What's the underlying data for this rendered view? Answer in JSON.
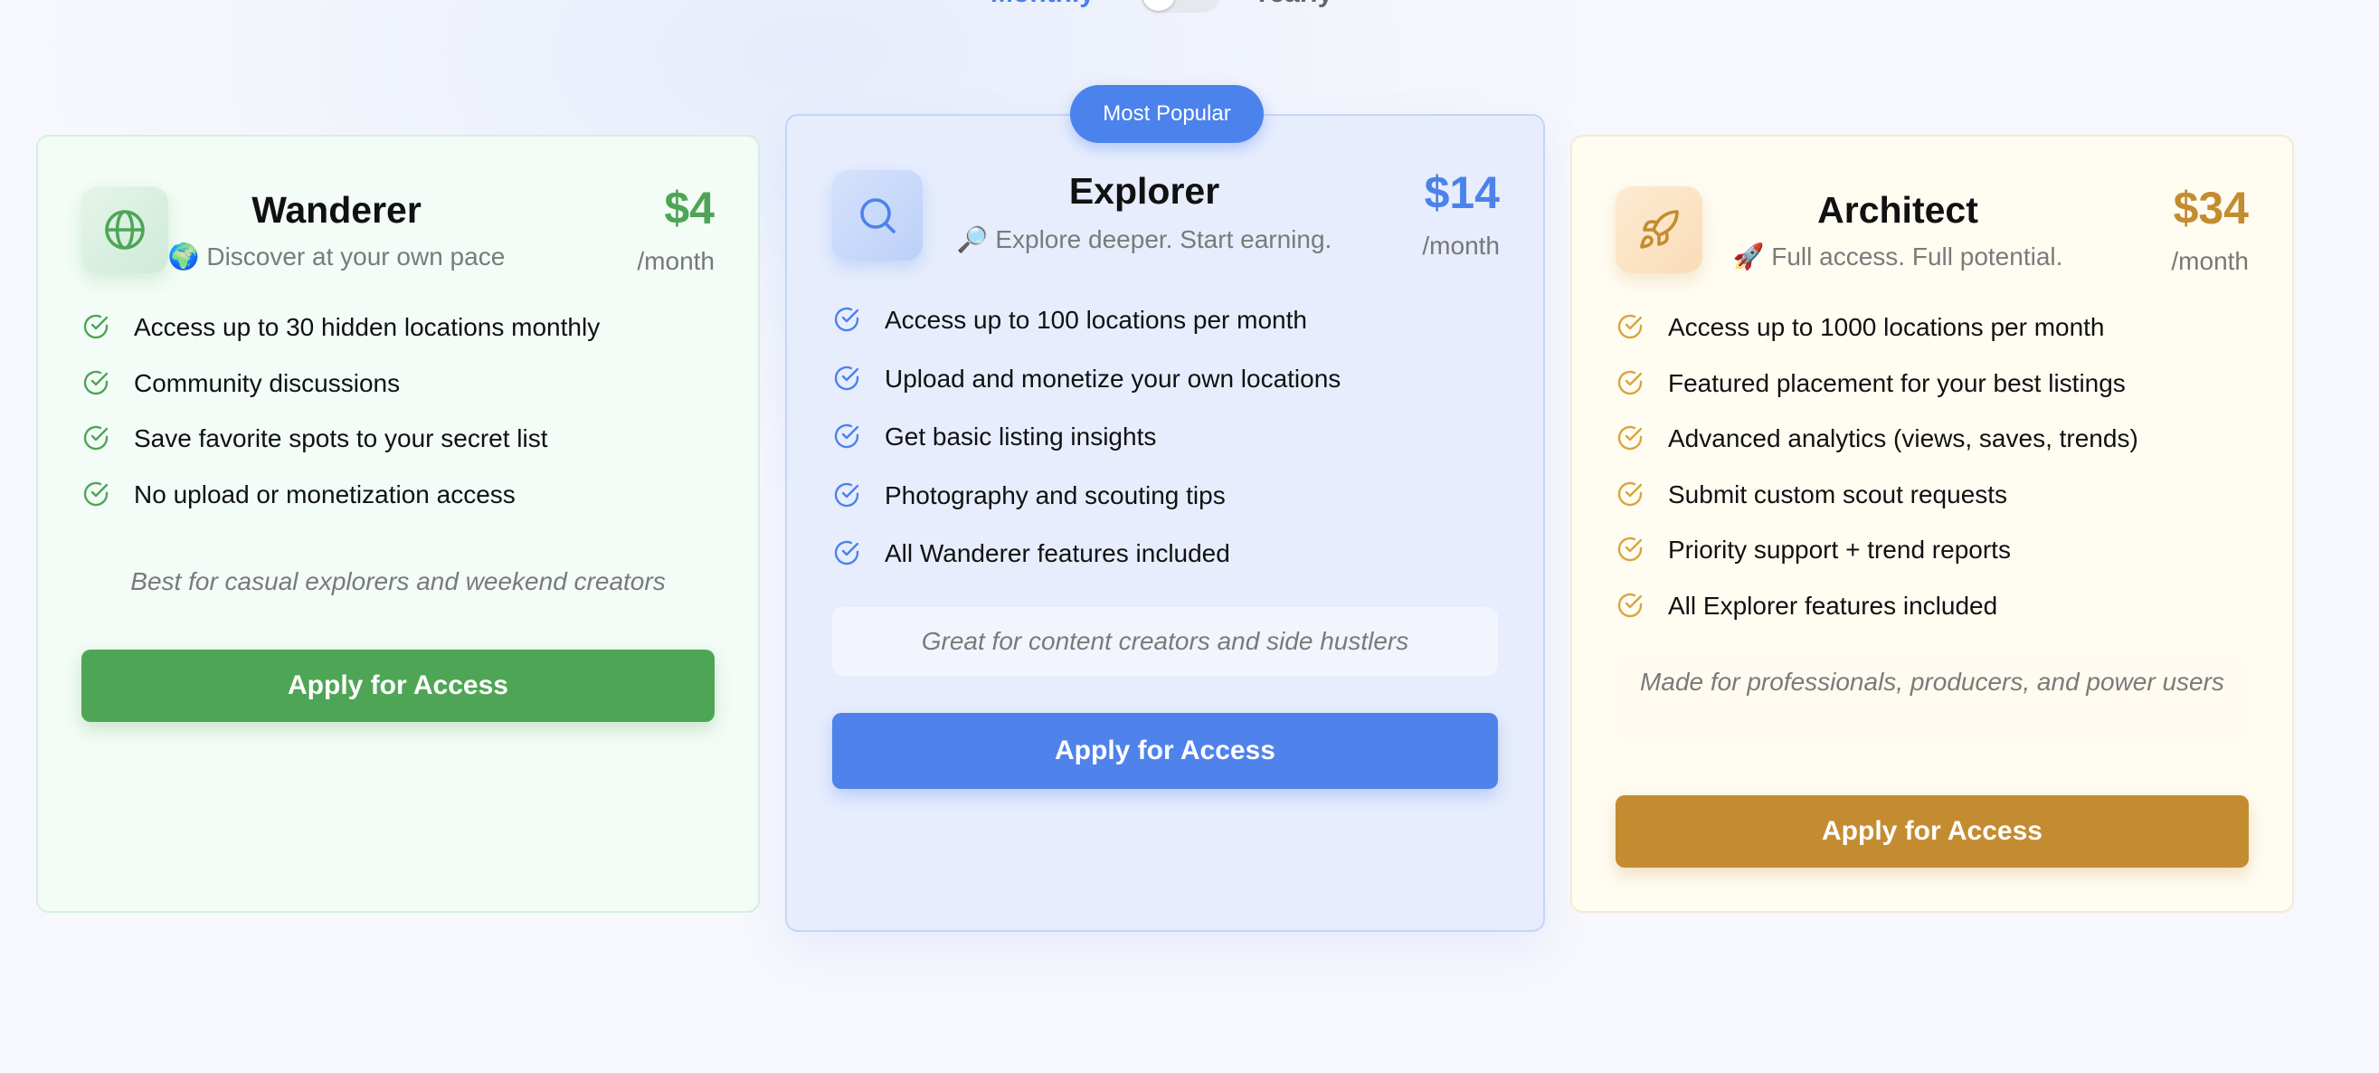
{
  "billing_toggle": {
    "monthly_label": "Monthly",
    "yearly_label": "Yearly",
    "selected": "Monthly"
  },
  "colors": {
    "wanderer_accent": "#4ea556",
    "explorer_accent": "#4b82ec",
    "architect_accent": "#c48c30"
  },
  "plans": [
    {
      "icon": "globe-icon",
      "name": "Wanderer",
      "tagline": "🌍 Discover at your own pace",
      "price": "$4",
      "period": "/month",
      "features": [
        "Access up to 30 hidden locations monthly",
        "Community discussions",
        "Save favorite spots to your secret list",
        "No upload or monetization access"
      ],
      "best_for": "Best for casual explorers and weekend creators",
      "cta": "Apply for Access"
    },
    {
      "badge": "Most Popular",
      "icon": "search-icon",
      "name": "Explorer",
      "tagline": "🔎 Explore deeper. Start earning.",
      "price": "$14",
      "period": "/month",
      "features": [
        "Access up to 100 locations per month",
        "Upload and monetize your own locations",
        "Get basic listing insights",
        "Photography and scouting tips",
        "All Wanderer features included"
      ],
      "best_for": "Great for content creators and side hustlers",
      "cta": "Apply for Access"
    },
    {
      "icon": "rocket-icon",
      "name": "Architect",
      "tagline": "🚀 Full access. Full potential.",
      "price": "$34",
      "period": "/month",
      "features": [
        "Access up to 1000 locations per month",
        "Featured placement for your best listings",
        "Advanced analytics (views, saves, trends)",
        "Submit custom scout requests",
        "Priority support + trend reports",
        "All Explorer features included"
      ],
      "best_for": "Made for professionals, producers, and power users",
      "cta": "Apply for Access"
    }
  ]
}
